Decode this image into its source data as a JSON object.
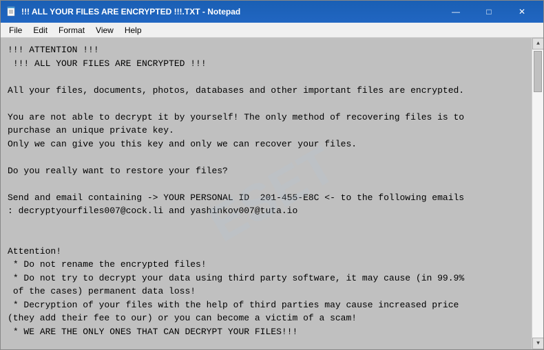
{
  "window": {
    "title": "!!! ALL YOUR FILES ARE ENCRYPTED !!!.TXT - Notepad",
    "icon": "📄"
  },
  "title_buttons": {
    "minimize": "—",
    "maximize": "□",
    "close": "✕"
  },
  "menu": {
    "items": [
      "File",
      "Edit",
      "Format",
      "View",
      "Help"
    ]
  },
  "content": {
    "text": "!!! ATTENTION !!!\n !!! ALL YOUR FILES ARE ENCRYPTED !!!\n\nAll your files, documents, photos, databases and other important files are encrypted.\n\nYou are not able to decrypt it by yourself! The only method of recovering files is to\npurchase an unique private key.\nOnly we can give you this key and only we can recover your files.\n\nDo you really want to restore your files?\n\nSend and email containing -> YOUR PERSONAL ID  201-455-E8C <- to the following emails\n: decryptyourfiles007@cock.li and yashinkov007@tuta.io\n\n\nAttention!\n * Do not rename the encrypted files!\n * Do not try to decrypt your data using third party software, it may cause (in 99.9%\n of the cases) permanent data loss!\n * Decryption of your files with the help of third parties may cause increased price\n(they add their fee to our) or you can become a victim of a scam!\n * WE ARE THE ONLY ONES THAT CAN DECRYPT YOUR FILES!!!"
  },
  "watermark": "ESET"
}
